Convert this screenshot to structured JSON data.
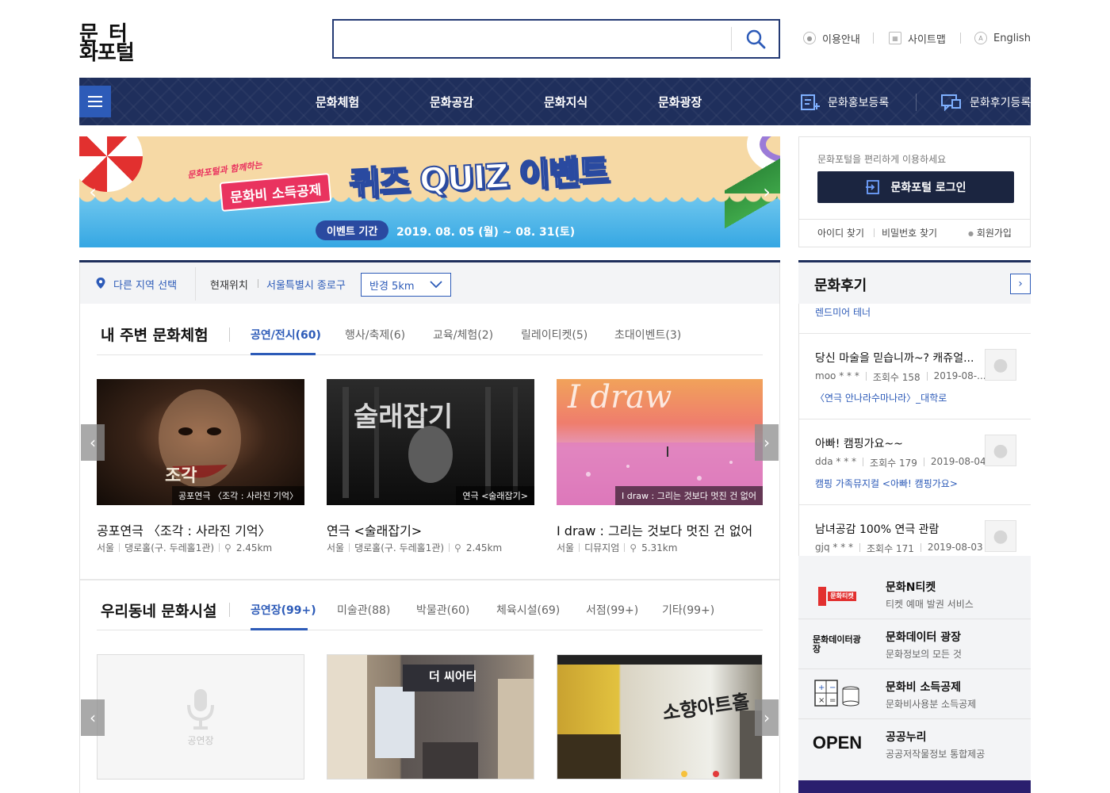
{
  "header": {
    "logo_line1": "문  터",
    "logo_line2": "화포털",
    "search_placeholder": "",
    "util_links": [
      {
        "label": "이용안내",
        "icon": "info-circle-icon"
      },
      {
        "label": "사이트맵",
        "icon": "sitemap-grid-icon"
      },
      {
        "label": "English",
        "icon": "language-icon"
      }
    ]
  },
  "nav": {
    "items": [
      "문화체험",
      "문화공감",
      "문화지식",
      "문화광장"
    ],
    "right": [
      {
        "label": "문화홍보등록",
        "icon": "promo-register-icon"
      },
      {
        "label": "문화후기등록",
        "icon": "review-register-icon"
      }
    ]
  },
  "banner": {
    "small_text": "문화포털과 함께하는",
    "tag": "문화비 소득공제",
    "title": "퀴즈 QUIZ 이벤트",
    "period_label": "이벤트 기간",
    "period": "2019. 08. 05 (월) ~ 08. 31(토)"
  },
  "login": {
    "hint": "문화포털을 편리하게 이용하세요",
    "button": "문화포털 로그인",
    "links": [
      "아이디 찾기",
      "비밀번호 찾기",
      "회원가입"
    ]
  },
  "location": {
    "other": "다른 지역 선택",
    "current_label": "현재위치",
    "current_value": "서울특별시 종로구",
    "radius": "반경 5km"
  },
  "nearby": {
    "title": "내 주변 문화체험",
    "tabs": [
      "공연/전시(60)",
      "행사/축제(6)",
      "교육/체험(2)",
      "릴레이티켓(5)",
      "초대이벤트(3)"
    ],
    "cards": [
      {
        "caption": "공포연극 〈조각 : 사라진 기억〉",
        "title": "공포연극 〈조각 : 사라진 기억〉",
        "region": "서울",
        "venue": "댕로홀(구. 두레홀1관)",
        "distance": "2.45km",
        "poster_text": "조각"
      },
      {
        "caption": "연극 <술래잡기>",
        "title": "연극 <술래잡기>",
        "region": "서울",
        "venue": "댕로홀(구. 두레홀1관)",
        "distance": "2.45km",
        "poster_text": "술래잡기"
      },
      {
        "caption": "I draw : 그리는 것보다 멋진 건 없어",
        "title": "I draw : 그리는 것보다 멋진 건 없어",
        "region": "서울",
        "venue": "디뮤지엄",
        "distance": "5.31km",
        "poster_text": "I draw"
      }
    ]
  },
  "facilities": {
    "title": "우리동네 문화시설",
    "tabs": [
      "공연장(99+)",
      "미술관(88)",
      "박물관(60)",
      "체육시설(69)",
      "서점(99+)",
      "기타(99+)"
    ],
    "placeholder_label": "공연장",
    "sign_1": "더 씨어터",
    "sign_2": "소향아트홀"
  },
  "reviews": {
    "title": "문화후기",
    "top_sub": "렌드미어 테너",
    "items": [
      {
        "title": "당신 마술을 믿습니까~? 캐쥬얼...",
        "user": "moo * * *",
        "views": "조회수 158",
        "date": "2019-08-...",
        "sub": "〈연극 안나라수마나라〉_대학로"
      },
      {
        "title": "아빠! 캠핑가요~~",
        "user": "dda * * *",
        "views": "조회수 179",
        "date": "2019-08-04",
        "sub": "캠핑 가족뮤지컬 <아빠! 캠핑가요>"
      },
      {
        "title": "남녀공감 100% 연극 관람",
        "user": "gjq * * *",
        "views": "조회수 171",
        "date": "2019-08-03",
        "sub": ""
      }
    ]
  },
  "services": [
    {
      "title": "문화N티켓",
      "desc": "티켓 예매 발권 서비스",
      "logo": "문화티켓"
    },
    {
      "title": "문화데이터 광장",
      "desc": "문화정보의 모든 것",
      "logo": "문화데이터광장"
    },
    {
      "title": "문화비 소득공제",
      "desc": "문화비사용분 소득공제",
      "logo": "calculator"
    },
    {
      "title": "공공누리",
      "desc": "공공저작물정보 통합제공",
      "logo": "OPEN"
    }
  ],
  "colors": {
    "navy": "#1f2f5c",
    "accent": "#2d5bb8",
    "login": "#1b2540",
    "pink": "#e9335f"
  }
}
